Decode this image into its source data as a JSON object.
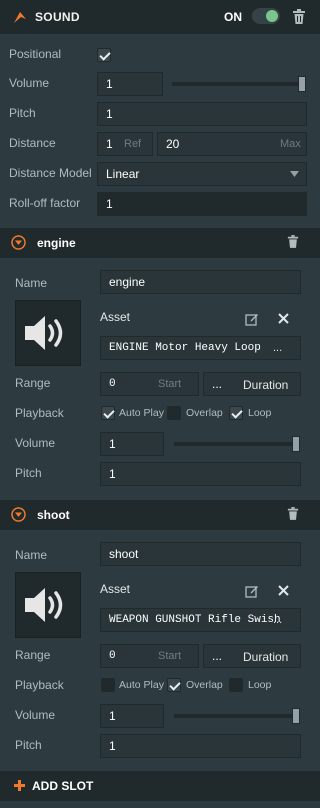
{
  "header": {
    "title": "SOUND",
    "on_label": "ON",
    "enabled": true
  },
  "component": {
    "positional_label": "Positional",
    "positional_checked": true,
    "volume_label": "Volume",
    "volume_value": "1",
    "volume_level": 1.0,
    "pitch_label": "Pitch",
    "pitch_value": "1",
    "distance_label": "Distance",
    "distance_ref_value": "1",
    "distance_ref_hint": "Ref",
    "distance_max_value": "20",
    "distance_max_hint": "Max",
    "distance_model_label": "Distance Model",
    "distance_model_value": "Linear",
    "rolloff_label": "Roll-off factor",
    "rolloff_value": "1"
  },
  "slots": [
    {
      "name": "engine",
      "name_label": "Name",
      "name_value": "engine",
      "asset_label": "Asset",
      "asset_value": "ENGINE Motor Heavy Loop",
      "asset_more": "...",
      "range_label": "Range",
      "range_start_value": "0",
      "range_start_hint": "Start",
      "range_duration_value": "...",
      "range_duration_hint": "Duration",
      "playback_label": "Playback",
      "autoplay_label": "Auto Play",
      "autoplay_checked": true,
      "overlap_label": "Overlap",
      "overlap_checked": false,
      "loop_label": "Loop",
      "loop_checked": true,
      "volume_label": "Volume",
      "volume_value": "1",
      "volume_level": 1.0,
      "pitch_label": "Pitch",
      "pitch_value": "1"
    },
    {
      "name": "shoot",
      "name_label": "Name",
      "name_value": "shoot",
      "asset_label": "Asset",
      "asset_value": "WEAPON GUNSHOT Rifle Swish",
      "asset_more": "...",
      "range_label": "Range",
      "range_start_value": "0",
      "range_start_hint": "Start",
      "range_duration_value": "...",
      "range_duration_hint": "Duration",
      "playback_label": "Playback",
      "autoplay_label": "Auto Play",
      "autoplay_checked": false,
      "overlap_label": "Overlap",
      "overlap_checked": true,
      "loop_label": "Loop",
      "loop_checked": false,
      "volume_label": "Volume",
      "volume_value": "1",
      "volume_level": 1.0,
      "pitch_label": "Pitch",
      "pitch_value": "1"
    }
  ],
  "add_slot_label": "ADD SLOT",
  "colors": {
    "accent": "#f07a2c",
    "toggle_on": "#7cc38e",
    "panel": "#2d3a3f",
    "header": "#20292b"
  },
  "icons": [
    "sound-component-icon",
    "trash-icon",
    "collapse-arrow-icon",
    "speaker-icon",
    "edit-icon",
    "close-icon",
    "plus-icon",
    "dropdown-caret-icon"
  ]
}
